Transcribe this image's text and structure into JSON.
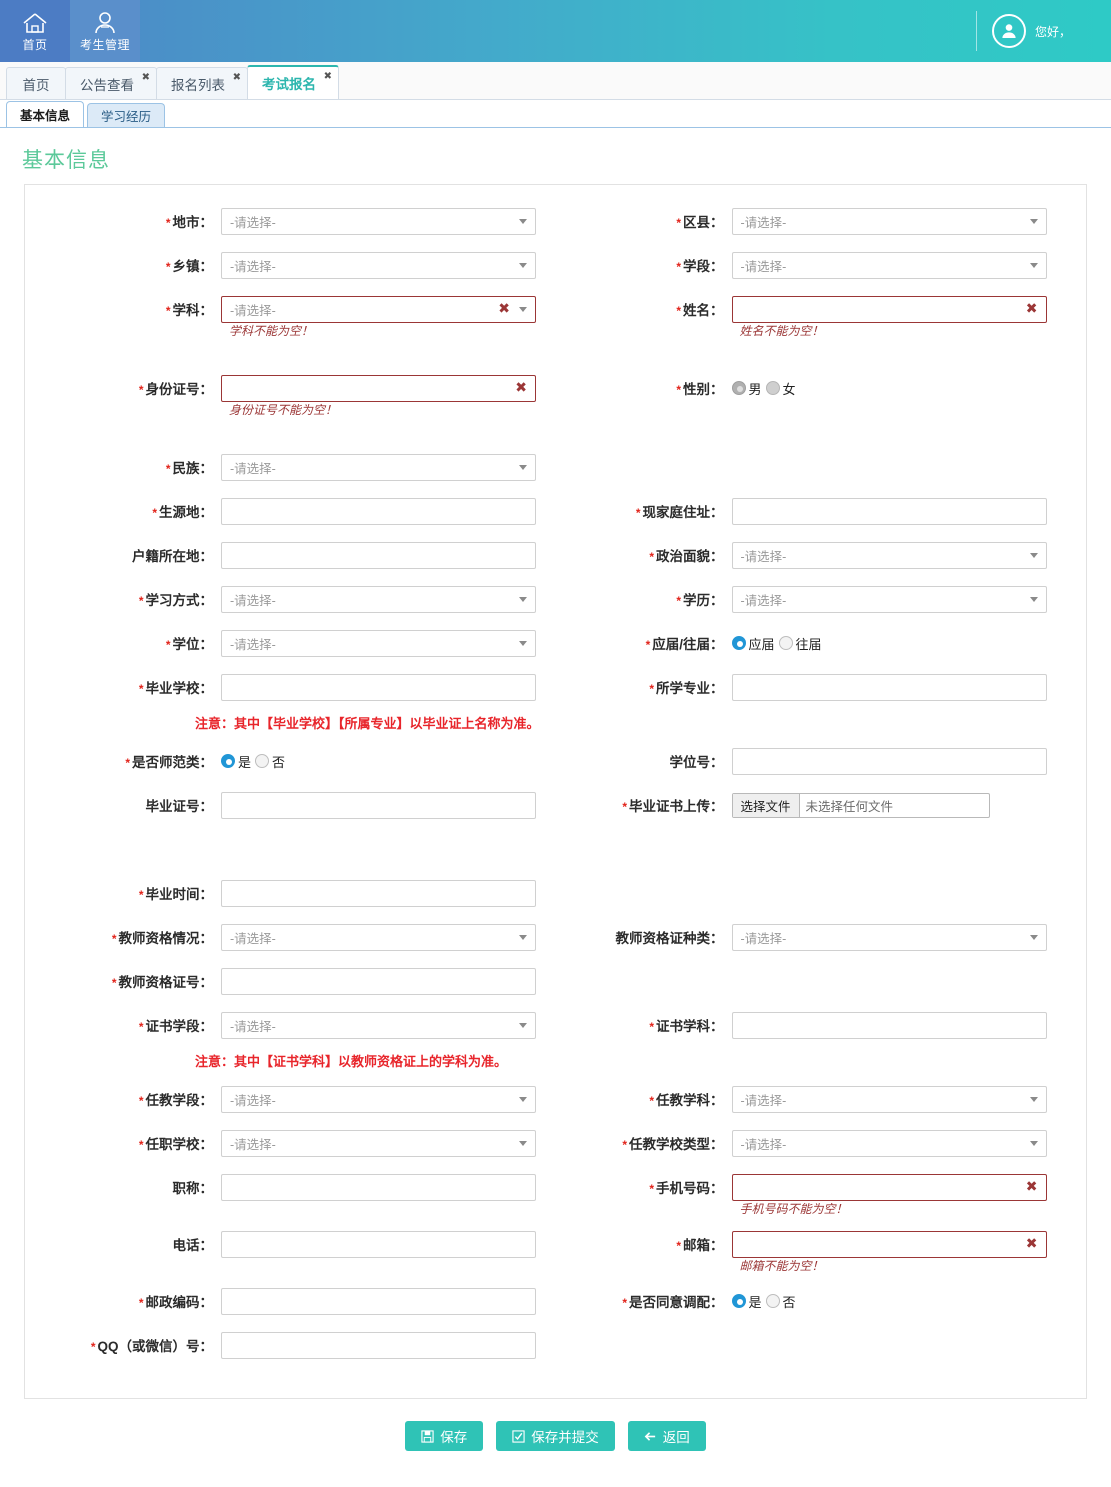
{
  "header": {
    "nav": [
      {
        "label": "首页",
        "icon": "home-icon"
      },
      {
        "label": "考生管理",
        "icon": "user-管理-icon"
      }
    ],
    "greeting": "您好，"
  },
  "tabs": [
    {
      "label": "首页",
      "closable": false,
      "active": false
    },
    {
      "label": "公告查看",
      "closable": true,
      "active": false
    },
    {
      "label": "报名列表",
      "closable": true,
      "active": false
    },
    {
      "label": "考试报名",
      "closable": true,
      "active": true
    }
  ],
  "subtabs": [
    {
      "label": "基本信息",
      "active": true
    },
    {
      "label": "学习经历",
      "active": false
    }
  ],
  "page": {
    "title": "基本信息",
    "select_placeholder": "-请选择-"
  },
  "notices": {
    "graduation": "注意：其中【毕业学校】【所属专业】以毕业证上名称为准。",
    "certificate": "注意：其中【证书学科】以教师资格证上的学科为准。"
  },
  "fields": {
    "city": {
      "label": "地市",
      "required": true,
      "value": "-请选择-"
    },
    "district": {
      "label": "区县",
      "required": true,
      "value": "-请选择-"
    },
    "town": {
      "label": "乡镇",
      "required": true,
      "value": "-请选择-"
    },
    "stage": {
      "label": "学段",
      "required": true,
      "value": "-请选择-"
    },
    "subject": {
      "label": "学科",
      "required": true,
      "value": "-请选择-",
      "error": "学科不能为空！"
    },
    "name": {
      "label": "姓名",
      "required": true,
      "value": "",
      "error": "姓名不能为空！"
    },
    "idcard": {
      "label": "身份证号",
      "required": true,
      "value": "",
      "error": "身份证号不能为空！"
    },
    "gender": {
      "label": "性别",
      "required": true,
      "options": [
        "男",
        "女"
      ],
      "selected": "男",
      "disabled": true
    },
    "nation": {
      "label": "民族",
      "required": true,
      "value": "-请选择-"
    },
    "origin": {
      "label": "生源地",
      "required": true,
      "value": ""
    },
    "home_address": {
      "label": "现家庭住址",
      "required": true,
      "value": ""
    },
    "household": {
      "label": "户籍所在地",
      "required": false,
      "value": ""
    },
    "political": {
      "label": "政治面貌",
      "required": true,
      "value": "-请选择-"
    },
    "study_mode": {
      "label": "学习方式",
      "required": true,
      "value": "-请选择-"
    },
    "education": {
      "label": "学历",
      "required": true,
      "value": "-请选择-"
    },
    "degree": {
      "label": "学位",
      "required": true,
      "value": "-请选择-"
    },
    "grad_type": {
      "label": "应届/往届",
      "required": true,
      "options": [
        "应届",
        "往届"
      ],
      "selected": "应届"
    },
    "grad_school": {
      "label": "毕业学校",
      "required": true,
      "value": ""
    },
    "major": {
      "label": "所学专业",
      "required": true,
      "value": ""
    },
    "is_normal": {
      "label": "是否师范类",
      "required": true,
      "options": [
        "是",
        "否"
      ],
      "selected": "是"
    },
    "degree_no": {
      "label": "学位号",
      "required": false,
      "value": ""
    },
    "diploma_no": {
      "label": "毕业证号",
      "required": false,
      "value": ""
    },
    "diploma_upload": {
      "label": "毕业证书上传",
      "required": true,
      "button": "选择文件",
      "status": "未选择任何文件"
    },
    "grad_time": {
      "label": "毕业时间",
      "required": true,
      "value": ""
    },
    "tq_status": {
      "label": "教师资格情况",
      "required": true,
      "value": "-请选择-"
    },
    "tq_type": {
      "label": "教师资格证种类",
      "required": false,
      "value": "-请选择-"
    },
    "tq_no": {
      "label": "教师资格证号",
      "required": true,
      "value": ""
    },
    "cert_stage": {
      "label": "证书学段",
      "required": true,
      "value": "-请选择-"
    },
    "cert_subject": {
      "label": "证书学科",
      "required": true,
      "value": ""
    },
    "teach_stage": {
      "label": "任教学段",
      "required": true,
      "value": "-请选择-"
    },
    "teach_subject": {
      "label": "任教学科",
      "required": true,
      "value": "-请选择-"
    },
    "work_school": {
      "label": "任职学校",
      "required": true,
      "value": "-请选择-"
    },
    "school_type": {
      "label": "任教学校类型",
      "required": true,
      "value": "-请选择-"
    },
    "title_rank": {
      "label": "职称",
      "required": false,
      "value": ""
    },
    "mobile": {
      "label": "手机号码",
      "required": true,
      "value": "",
      "error": "手机号码不能为空！"
    },
    "telephone": {
      "label": "电话",
      "required": false,
      "value": ""
    },
    "email": {
      "label": "邮箱",
      "required": true,
      "value": "",
      "error": "邮箱不能为空！"
    },
    "postcode": {
      "label": "邮政编码",
      "required": true,
      "value": ""
    },
    "allow_adjust": {
      "label": "是否同意调配",
      "required": true,
      "options": [
        "是",
        "否"
      ],
      "selected": "是"
    },
    "qq": {
      "label": "QQ（或微信）号",
      "required": true,
      "value": ""
    }
  },
  "footer": {
    "save": "保存",
    "save_submit": "保存并提交",
    "back": "返回"
  },
  "colors": {
    "accent_teal": "#2fc3b6",
    "header_blue": "#4b7fc6",
    "title_green": "#5cc99a",
    "error_red": "#9b3636",
    "notice_red": "#e8252b",
    "radio_blue": "#2196d6"
  }
}
